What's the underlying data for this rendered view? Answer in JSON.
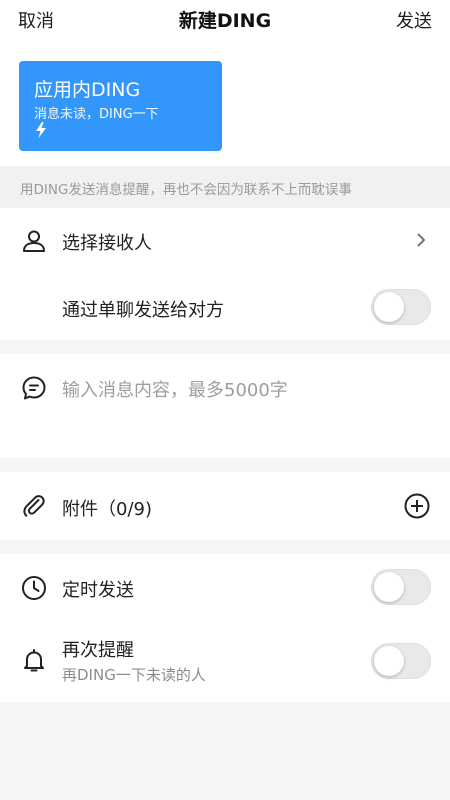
{
  "header": {
    "cancel_label": "取消",
    "title": "新建DING",
    "send_label": "发送"
  },
  "ding_type": {
    "name": "应用内DING",
    "description": "消息未读，DING一下",
    "icon": "lightning-bolt-icon",
    "accent_color": "#3296fa"
  },
  "tip_text": "用DING发送消息提醒，再也不会因为联系不上而耽误事",
  "recipients": {
    "label": "选择接收人",
    "icon": "person-icon"
  },
  "private_chat": {
    "label": "通过单聊发送给对方",
    "enabled": false
  },
  "message": {
    "placeholder": "输入消息内容，最多5000字",
    "icon": "chat-bubble-icon"
  },
  "attachment": {
    "label": "附件（0/9)",
    "icon": "paperclip-icon"
  },
  "schedule": {
    "label": "定时发送",
    "icon": "clock-icon",
    "enabled": false
  },
  "reminder": {
    "label": "再次提醒",
    "sublabel": "再DING一下未读的人",
    "icon": "bell-icon",
    "enabled": false
  }
}
